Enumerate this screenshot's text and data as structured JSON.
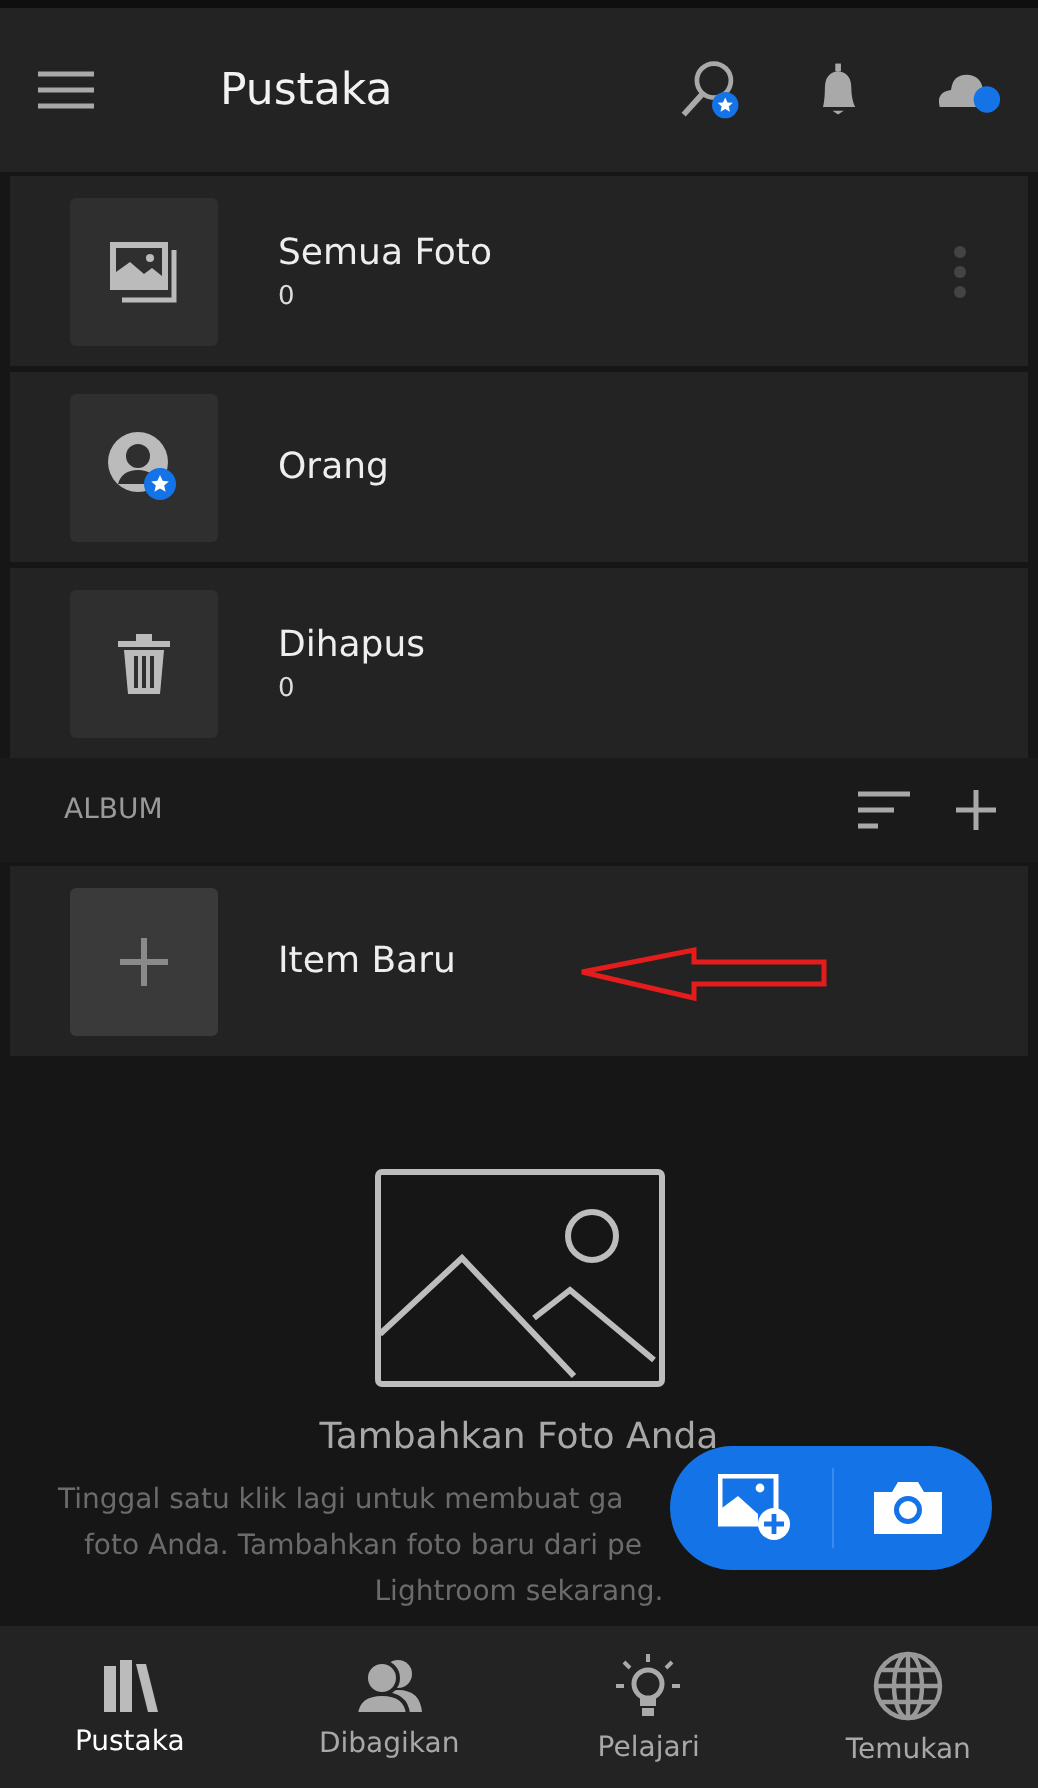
{
  "header": {
    "title": "Pustaka"
  },
  "library": [
    {
      "kind": "photos",
      "label": "Semua Foto",
      "count": "0",
      "menu": true
    },
    {
      "kind": "people",
      "label": "Orang",
      "menu": false
    },
    {
      "kind": "trash",
      "label": "Dihapus",
      "count": "0",
      "menu": false
    }
  ],
  "album_section": {
    "label": "ALBUM"
  },
  "albums": [
    {
      "kind": "new",
      "label": "Item Baru"
    }
  ],
  "empty_state": {
    "title": "Tambahkan Foto Anda",
    "lines": [
      "Tinggal satu klik lagi untuk membuat ga",
      "foto Anda. Tambahkan foto baru dari pe",
      "Lightroom sekarang."
    ]
  },
  "nav": [
    {
      "kind": "library",
      "label": "Pustaka",
      "selected": true
    },
    {
      "kind": "shared",
      "label": "Dibagikan",
      "selected": false
    },
    {
      "kind": "learn",
      "label": "Pelajari",
      "selected": false
    },
    {
      "kind": "discover",
      "label": "Temukan",
      "selected": false
    }
  ]
}
